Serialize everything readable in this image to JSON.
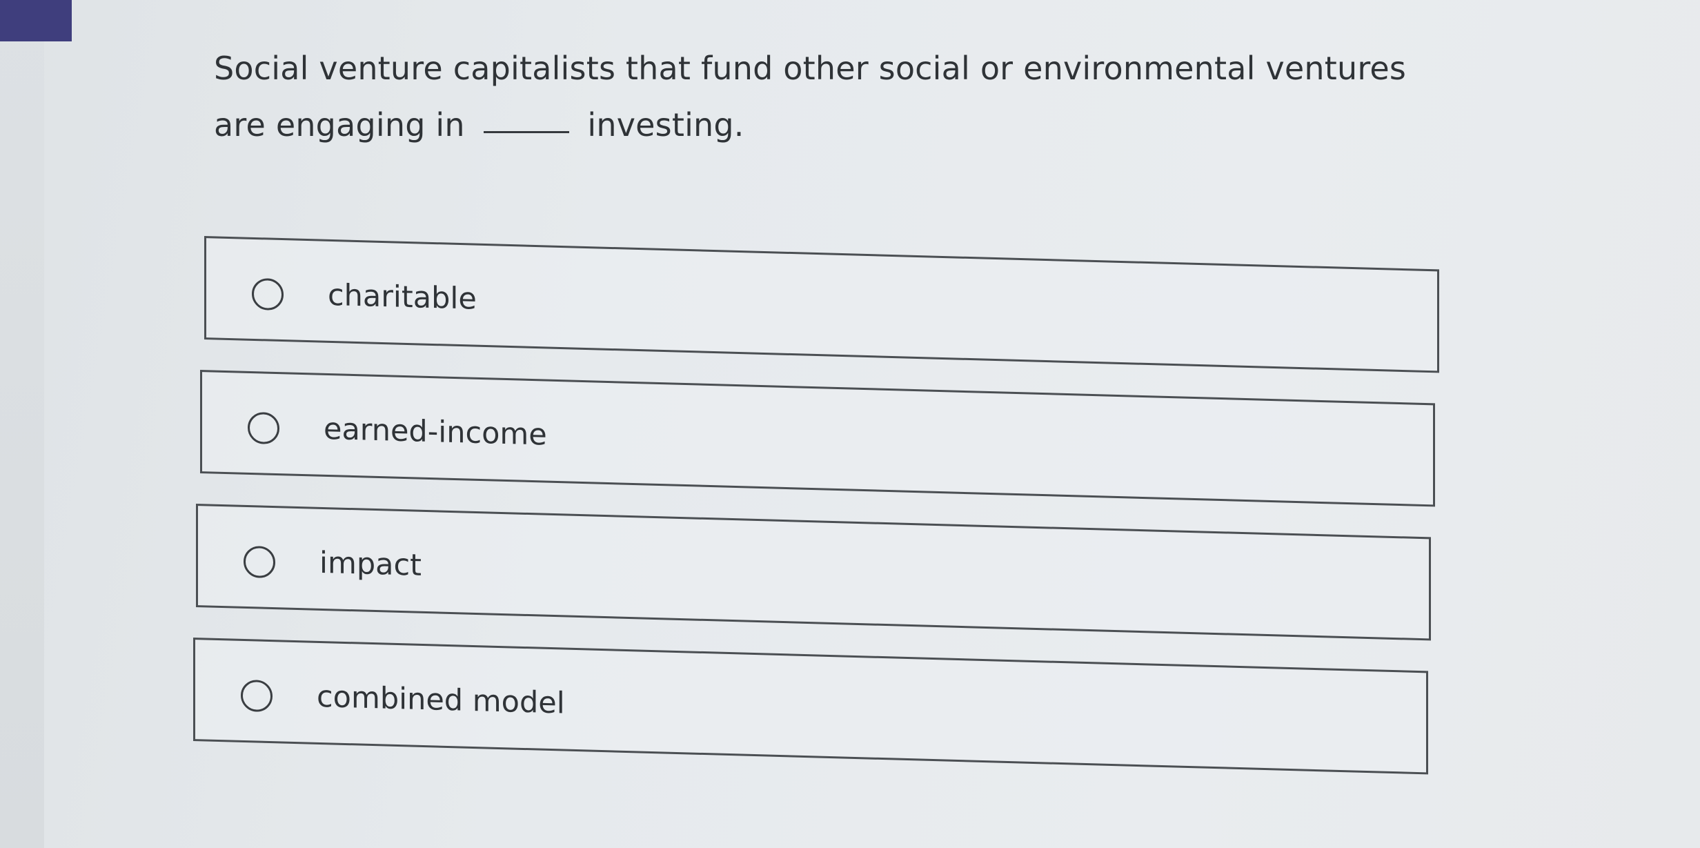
{
  "question": {
    "text_before_blank": "Social venture capitalists that fund other social or environmental ventures are engaging in",
    "text_after_blank": "investing."
  },
  "options": [
    {
      "label": "charitable",
      "selected": false
    },
    {
      "label": "earned-income",
      "selected": false
    },
    {
      "label": "impact",
      "selected": false
    },
    {
      "label": "combined model",
      "selected": false
    }
  ],
  "colors": {
    "accent": "#3f3e7d",
    "background": "#e6eaed",
    "border": "#4b4f53",
    "text": "#2f3337"
  }
}
